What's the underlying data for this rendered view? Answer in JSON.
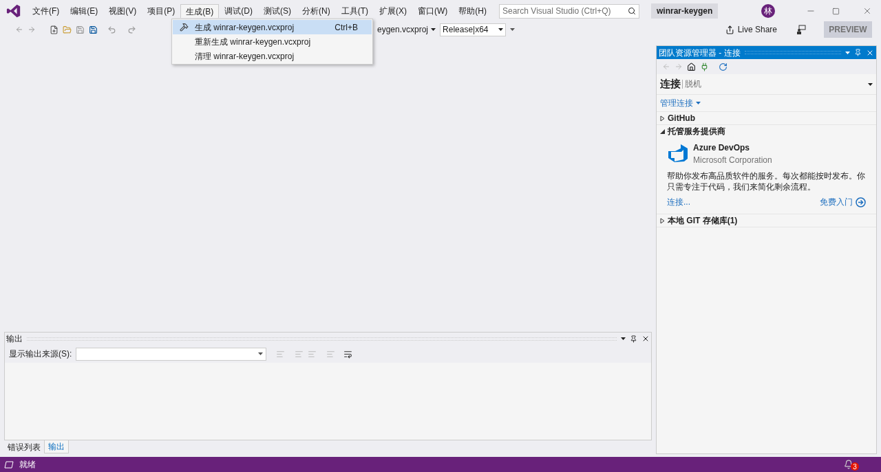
{
  "menu_bar": [
    {
      "label": "文件(F)",
      "selected": false
    },
    {
      "label": "编辑(E)",
      "selected": false
    },
    {
      "label": "视图(V)",
      "selected": false
    },
    {
      "label": "项目(P)",
      "selected": false
    },
    {
      "label": "生成(B)",
      "selected": true
    },
    {
      "label": "调试(D)",
      "selected": false
    },
    {
      "label": "测试(S)",
      "selected": false
    },
    {
      "label": "分析(N)",
      "selected": false
    },
    {
      "label": "工具(T)",
      "selected": false
    },
    {
      "label": "扩展(X)",
      "selected": false
    },
    {
      "label": "窗口(W)",
      "selected": false
    },
    {
      "label": "帮助(H)",
      "selected": false
    }
  ],
  "search": {
    "placeholder": "Search Visual Studio (Ctrl+Q)"
  },
  "solution_name": "winrar-keygen",
  "avatar": "林",
  "build_menu": [
    {
      "label": "生成 winrar-keygen.vcxproj",
      "shortcut": "Ctrl+B",
      "selected": true,
      "kind": "build"
    },
    {
      "label": "重新生成 winrar-keygen.vcxproj",
      "selected": false,
      "kind": "plain"
    },
    {
      "label": "清理 winrar-keygen.vcxproj",
      "selected": false,
      "kind": "plain"
    }
  ],
  "toolbar": {
    "startup_project": "eygen.vcxproj",
    "configuration": "Release|x64",
    "live_share": "Live Share",
    "preview": "PREVIEW"
  },
  "team_explorer": {
    "title": "团队资源管理器 - 连接",
    "heading": "连接",
    "subheading": "脱机",
    "manage": "管理连接",
    "sections": [
      {
        "label": "GitHub",
        "expanded": false
      },
      {
        "label": "托管服务提供商",
        "expanded": true,
        "provider": {
          "name": "Azure DevOps",
          "company": "Microsoft Corporation",
          "description": "帮助你发布高品质软件的服务。每次都能按时发布。你只需专注于代码，我们来简化剩余流程。",
          "connect": "连接...",
          "get_started": "免费入门"
        }
      },
      {
        "label": "本地 GIT 存储库(1)",
        "expanded": false
      }
    ]
  },
  "output": {
    "title": "输出",
    "source_label": "显示输出来源(S):"
  },
  "bottom_tabs": [
    {
      "label": "错误列表",
      "selected": false
    },
    {
      "label": "输出",
      "selected": true
    }
  ],
  "status_bar": {
    "text": "就绪",
    "notifications": "3"
  }
}
